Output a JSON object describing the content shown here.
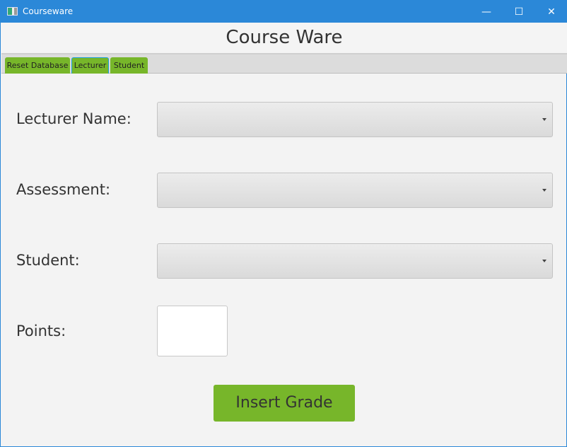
{
  "window": {
    "title": "Courseware",
    "minimize": "—",
    "maximize": "☐",
    "close": "✕"
  },
  "header": {
    "title": "Course Ware"
  },
  "tabs": [
    {
      "label": "Reset Database"
    },
    {
      "label": "Lecturer",
      "selected": true
    },
    {
      "label": "Student"
    }
  ],
  "form": {
    "lecturer_label": "Lecturer Name:",
    "assessment_label": "Assessment:",
    "student_label": "Student:",
    "points_label": "Points:",
    "points_value": "",
    "submit_label": "Insert Grade"
  },
  "colors": {
    "titlebar": "#2b88d8",
    "accent": "#77b62a"
  }
}
